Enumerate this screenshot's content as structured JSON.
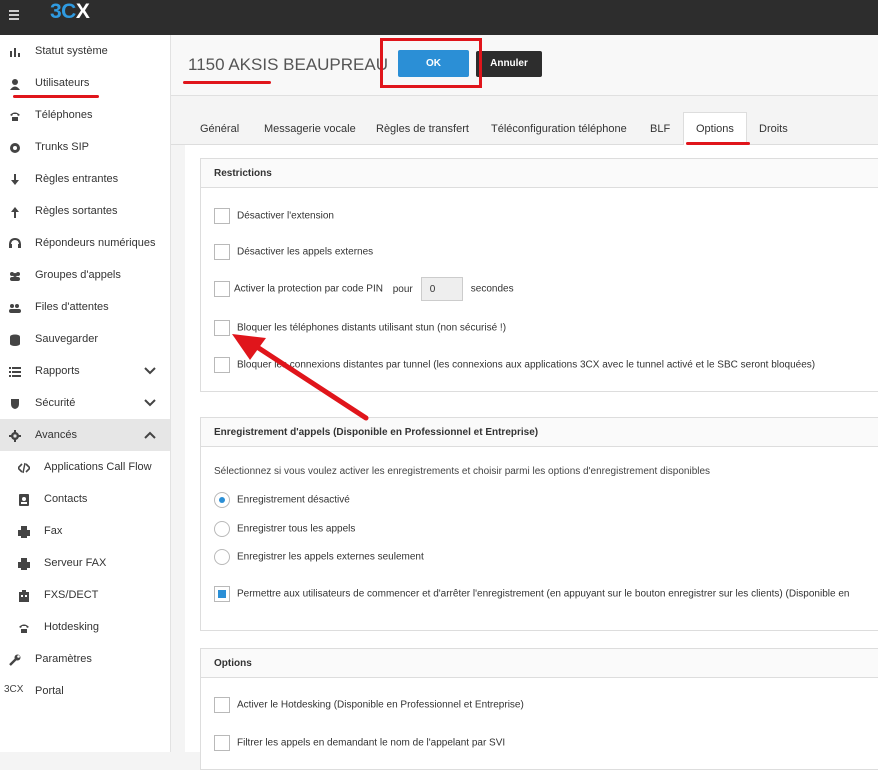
{
  "app": {
    "logo_part1": "3C",
    "logo_part2": "X"
  },
  "sidebar": {
    "items": [
      {
        "label": "Statut système",
        "icon": "bar-chart-icon"
      },
      {
        "label": "Utilisateurs",
        "icon": "user-icon"
      },
      {
        "label": "Téléphones",
        "icon": "phone-icon"
      },
      {
        "label": "Trunks SIP",
        "icon": "globe-icon"
      },
      {
        "label": "Règles entrantes",
        "icon": "arrow-down-icon"
      },
      {
        "label": "Règles sortantes",
        "icon": "arrow-up-icon"
      },
      {
        "label": "Répondeurs numériques",
        "icon": "headset-icon"
      },
      {
        "label": "Groupes d'appels",
        "icon": "group-icon"
      },
      {
        "label": "Files d'attentes",
        "icon": "queue-icon"
      },
      {
        "label": "Sauvegarder",
        "icon": "database-icon"
      },
      {
        "label": "Rapports",
        "icon": "list-icon"
      },
      {
        "label": "Sécurité",
        "icon": "shield-icon"
      },
      {
        "label": "Avancés",
        "icon": "gear-icon"
      },
      {
        "label": "Applications Call Flow",
        "icon": "code-icon"
      },
      {
        "label": "Contacts",
        "icon": "contact-card-icon"
      },
      {
        "label": "Fax",
        "icon": "fax-icon"
      },
      {
        "label": "Serveur FAX",
        "icon": "fax-server-icon"
      },
      {
        "label": "FXS/DECT",
        "icon": "fxs-icon"
      },
      {
        "label": "Hotdesking",
        "icon": "hotdesk-phone-icon"
      },
      {
        "label": "Paramètres",
        "icon": "wrench-icon"
      },
      {
        "label": "Portal",
        "icon": "3cx-icon"
      }
    ],
    "portal_icon_text": "3CX"
  },
  "header": {
    "title": "1150 AKSIS BEAUPREAU",
    "ok_label": "OK",
    "cancel_label": "Annuler"
  },
  "tabs": [
    "Général",
    "Messagerie vocale",
    "Règles de transfert",
    "Téléconfiguration téléphone",
    "BLF",
    "Options",
    "Droits"
  ],
  "restrictions": {
    "title": "Restrictions",
    "disable_extension": "Désactiver l'extension",
    "disable_external": "Désactiver les appels externes",
    "pin_label": "Activer la protection par code PIN",
    "pin_for": "pour",
    "pin_value": "0",
    "pin_unit": "secondes",
    "block_stun": "Bloquer les téléphones distants utilisant stun (non sécurisé !)",
    "block_tunnel": "Bloquer les connexions distantes par tunnel (les connexions aux applications 3CX avec le tunnel activé et le SBC seront bloquées)"
  },
  "recording": {
    "title": "Enregistrement d'appels (Disponible en Professionnel et Entreprise)",
    "description": "Sélectionnez si vous voulez activer les enregistrements et choisir parmi les options d'enregistrement disponibles",
    "opt_disabled": "Enregistrement désactivé",
    "opt_all": "Enregistrer tous les appels",
    "opt_external": "Enregistrer les appels externes seulement",
    "allow_users": "Permettre aux utilisateurs de commencer et d'arrêter l'enregistrement (en appuyant sur le bouton enregistrer sur les clients) (Disponible en"
  },
  "options": {
    "title": "Options",
    "hotdesking": "Activer le Hotdesking (Disponible en Professionnel et Entreprise)",
    "filter_ivr": "Filtrer les appels en demandant le nom de l'appelant par SVI"
  },
  "colors": {
    "accent": "#2b8fd6",
    "annotation": "#e0151b",
    "topbar": "#2d2d2d"
  }
}
